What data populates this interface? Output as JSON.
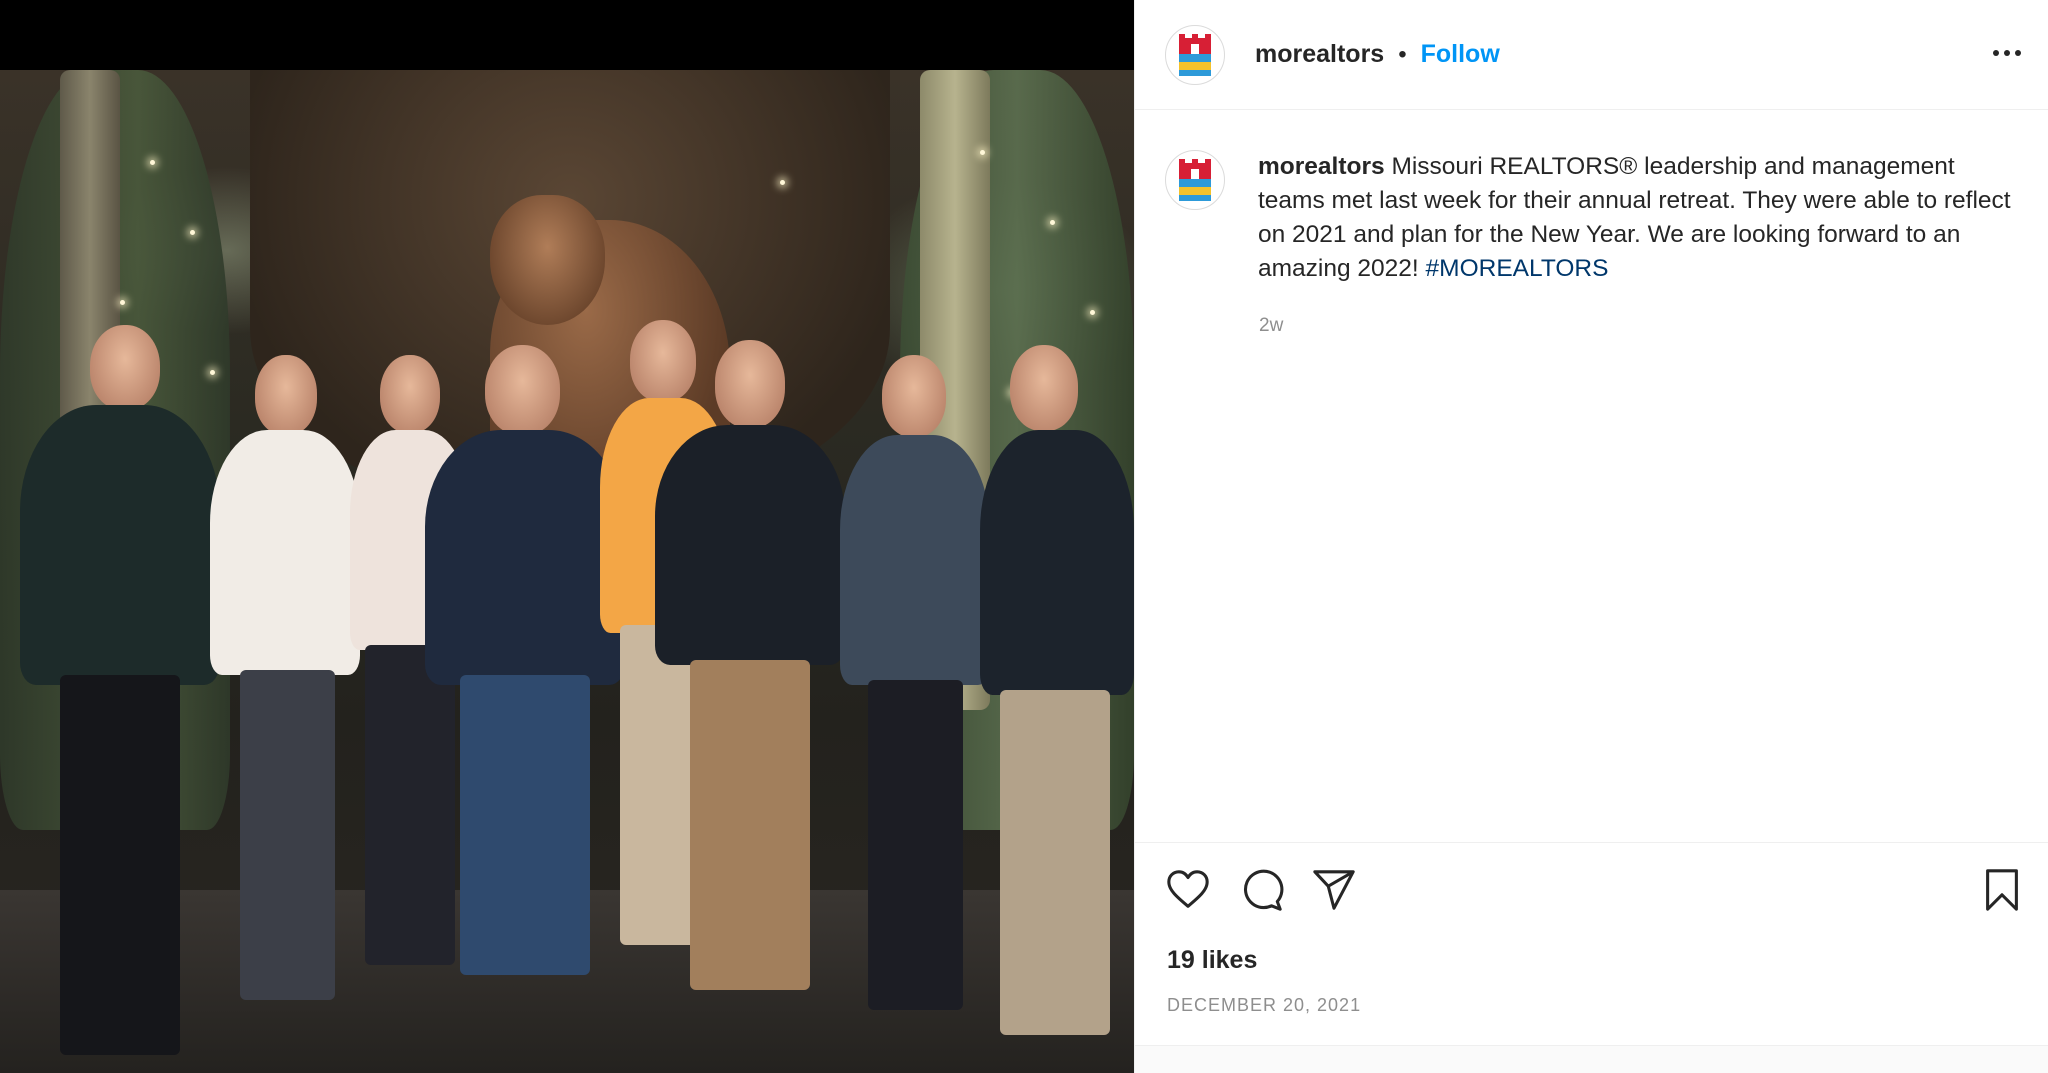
{
  "post": {
    "username": "morealtors",
    "separator": "•",
    "follow_label": "Follow",
    "caption_user": "morealtors",
    "caption_body": "Missouri REALTORS® leadership and management teams met last week for their annual retreat. They were able to reflect on 2021 and plan for the New Year. We are looking forward to an amazing 2022!",
    "hashtag": "#MOREALTORS",
    "time_ago": "2w",
    "likes": "19 likes",
    "date": "DECEMBER 20, 2021"
  },
  "icons": {
    "avatar": "realtors-logo-icon",
    "more": "more-options-icon",
    "like": "heart-icon",
    "comment": "comment-icon",
    "share": "paper-plane-icon",
    "save": "bookmark-icon"
  },
  "colors": {
    "follow": "#0095f6",
    "hashtag": "#00376b",
    "text": "#262626",
    "muted": "#8e8e8e",
    "logo_red": "#d71f35",
    "logo_blue": "#2d9ad9",
    "logo_yellow": "#f4c22b"
  }
}
